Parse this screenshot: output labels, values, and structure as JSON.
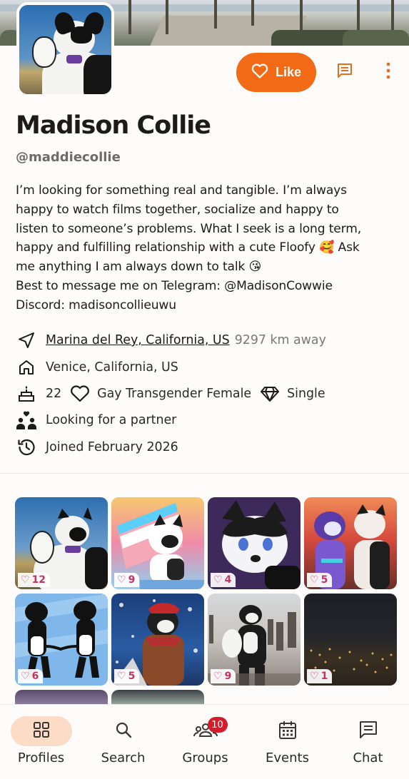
{
  "profile": {
    "name": "Madison Collie",
    "handle": "@maddiecollie",
    "bio": "I’m looking for something real and tangible. I’m always\nhappy to watch films together, socialize and happy to\nlisten to someone’s problems. What I seek is a long term,\nhappy and fulfilling relationship with a cute Floofy 🥰 Ask\nme anything I am always down to talk 😘\nBest to message me on Telegram: @MadisonCowwie\nDiscord: madisoncollieuwu"
  },
  "actions": {
    "like_label": "Like",
    "like_icon": "heart-outline-icon",
    "chat_icon": "chat-icon",
    "more_icon": "more-vertical-icon"
  },
  "details": {
    "location_link": "Marina del Rey, California, US",
    "distance": "9297 km away",
    "hometown": "Venice, California, US",
    "age": "22",
    "identity": "Gay Transgender Female",
    "status": "Single",
    "looking_for": "Looking for a partner",
    "joined": "Joined February 2026"
  },
  "gallery": [
    {
      "likes": "12"
    },
    {
      "likes": "9"
    },
    {
      "likes": "4"
    },
    {
      "likes": "5"
    },
    {
      "likes": "6"
    },
    {
      "likes": "5"
    },
    {
      "likes": "9"
    },
    {
      "likes": "1"
    }
  ],
  "nav": {
    "items": [
      {
        "label": "Profiles",
        "icon": "grid-icon"
      },
      {
        "label": "Search",
        "icon": "search-icon"
      },
      {
        "label": "Groups",
        "icon": "groups-icon",
        "badge": "10"
      },
      {
        "label": "Events",
        "icon": "calendar-icon"
      },
      {
        "label": "Chat",
        "icon": "chat-icon"
      }
    ]
  },
  "colors": {
    "accent": "#f26a15",
    "like_pink": "#c23360",
    "badge": "#d21d2a",
    "active_pill": "#fcdcc6"
  }
}
